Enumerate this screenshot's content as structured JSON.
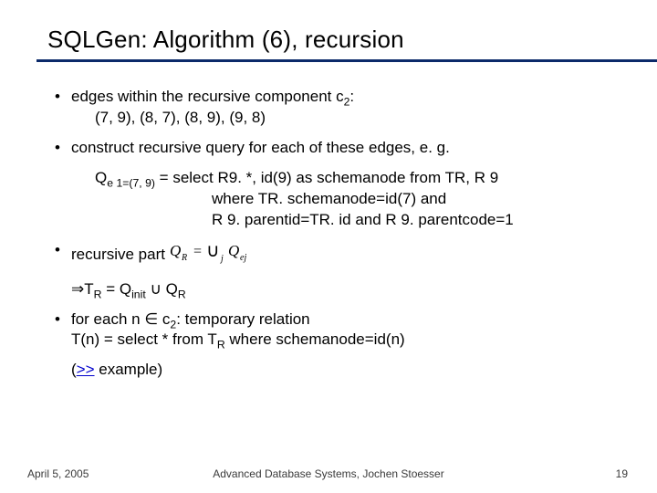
{
  "title": "SQLGen: Algorithm (6), recursion",
  "bullets": {
    "b1": {
      "line1": "edges within the recursive component c",
      "sub": "2",
      "line1tail": ":",
      "line2": "(7, 9), (8, 7), (8, 9), (9, 8)"
    },
    "b2": {
      "text": "construct recursive query for each of these edges, e. g."
    },
    "query": {
      "lhs_pre": "Q",
      "lhs_sub": "e 1=(7, 9)",
      "eq": " = ",
      "l1": "select R9. *, id(9) as schemanode from TR, R 9",
      "l2": "where TR. schemanode=id(7) and",
      "l3": "R 9. parentid=TR. id and R 9. parentcode=1"
    },
    "b3": {
      "text": "recursive part  ",
      "formula_alt": "Q_R = ⋃_j Q_ej"
    },
    "tr": {
      "arrow": "⇒",
      "pre": "T",
      "sub": "R",
      "mid": " = Q",
      "sub2": "init",
      "cup": " ∪ Q",
      "sub3": "R"
    },
    "b4": {
      "l1a": "for each n ",
      "in": "∈",
      "l1b": " c",
      "sub": "2",
      "l1c": ": temporary relation",
      "l2a": "T(n) = select * from T",
      "l2sub": "R",
      "l2b": " where schemanode=id(n)"
    },
    "link": {
      "open": "(",
      "text": ">>",
      "close": " example)"
    }
  },
  "footer": {
    "left": "April 5, 2005",
    "center": "Advanced Database Systems, Jochen Stoesser",
    "right": "19"
  }
}
